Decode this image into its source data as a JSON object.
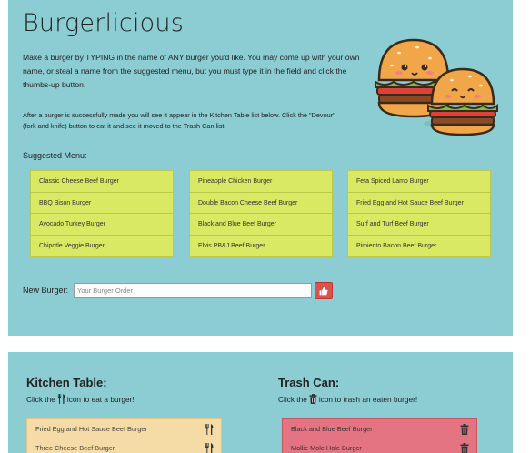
{
  "app": {
    "title": "Burgerlicious",
    "intro": "Make a burger by TYPING in the name of ANY burger you'd like. You may come up with your own name, or steal a name from the suggested menu, but you must type it in the field and click the thumbs-up button.",
    "note": "After a burger is successfully made you will see it appear in the Kitchen Table list below. Click the \"Devour\" (fork and knife) button to eat it and see it moved to the Trash Can list."
  },
  "menu": {
    "label": "Suggested Menu:",
    "columns": [
      [
        "Classic Cheese Beef Burger",
        "BBQ Bison Burger",
        "Avocado Turkey Burger",
        "Chipotle Veggie Burger"
      ],
      [
        "Pineapple Chicken Burger",
        "Double Bacon Cheese Beef Burger",
        "Black and Blue Beef Burger",
        "Elvis PB&J Beef Burger"
      ],
      [
        "Feta Spiced Lamb Burger",
        "Fried Egg and Hot Sauce Beef Burger",
        "Surf and Turf Beef Burger",
        "Pimiento Bacon Beef Burger"
      ]
    ]
  },
  "form": {
    "label": "New Burger:",
    "placeholder": "Your Burger Order",
    "value": "",
    "submit_icon": "thumbs-up-icon"
  },
  "kitchen": {
    "title": "Kitchen Table:",
    "sub_before": "Click the",
    "sub_after": "icon to eat a burger!",
    "icon": "fork-knife-icon",
    "items": [
      "Fried Egg and Hot Sauce Beef Burger",
      "Three Cheese Beef Burger"
    ]
  },
  "trash": {
    "title": "Trash Can:",
    "sub_before": "Click the",
    "sub_after": "icon to trash an eaten burger!",
    "icon": "trash-icon",
    "items": [
      "Black and Blue Beef Burger",
      "Mollie Mole Hole Burger"
    ]
  },
  "colors": {
    "background": "#8ccdd4",
    "menu_item": "#d9e963",
    "kitchen_item": "#f5dba6",
    "trash_item": "#e57483",
    "button": "#d9534f"
  }
}
